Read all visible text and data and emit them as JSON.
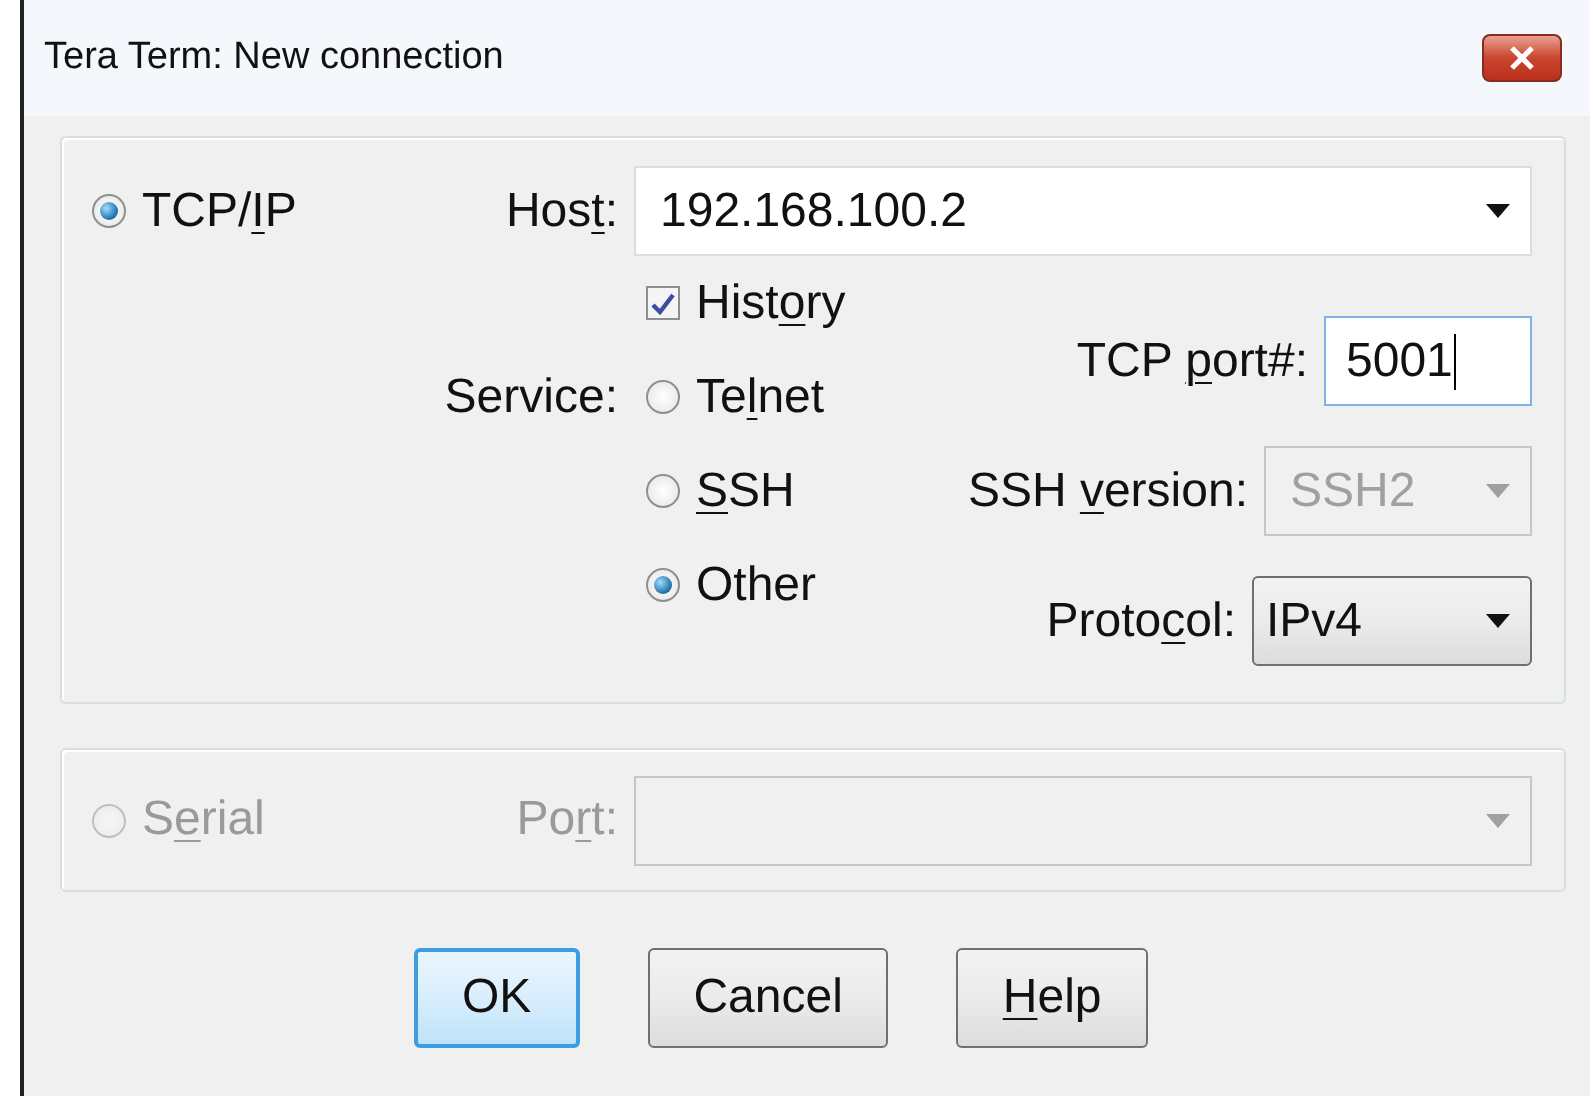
{
  "window": {
    "title": "Tera Term: New connection"
  },
  "tcpip": {
    "label": {
      "before": "TCP/",
      "key": "I",
      "after": "P"
    },
    "selected": true,
    "host": {
      "label": {
        "before": "Hos",
        "key": "t",
        "after": ":"
      },
      "value": "192.168.100.2"
    },
    "history": {
      "label": {
        "before": "Hist",
        "key": "o",
        "after": "ry"
      },
      "checked": true
    },
    "service": {
      "label": "Service:",
      "options": [
        {
          "label": {
            "before": "Te",
            "key": "l",
            "after": "net"
          },
          "selected": false
        },
        {
          "label": {
            "key": "S",
            "after": "SH"
          },
          "selected": false
        },
        {
          "label": {
            "before": "Other"
          },
          "selected": true
        }
      ]
    },
    "tcp_port": {
      "label": {
        "before": "TCP ",
        "key": "p",
        "after": "ort#:"
      },
      "value": "5001",
      "focused": true
    },
    "ssh_version": {
      "label": {
        "before": "SSH ",
        "key": "v",
        "after": "ersion:"
      },
      "value": "SSH2",
      "disabled": true
    },
    "protocol": {
      "label": {
        "before": "Proto",
        "key": "c",
        "after": "ol:"
      },
      "value": "IPv4",
      "disabled": false
    }
  },
  "serial": {
    "label": {
      "before": "S",
      "key": "e",
      "after": "rial"
    },
    "selected": false,
    "disabled": true,
    "port": {
      "label": {
        "before": "Po",
        "key": "r",
        "after": "t:"
      },
      "disabled": true
    }
  },
  "buttons": [
    {
      "label": {
        "before": "OK"
      },
      "default": true
    },
    {
      "label": {
        "before": "Cancel"
      },
      "default": false
    },
    {
      "label": {
        "key": "H",
        "after": "elp"
      },
      "default": false
    }
  ]
}
